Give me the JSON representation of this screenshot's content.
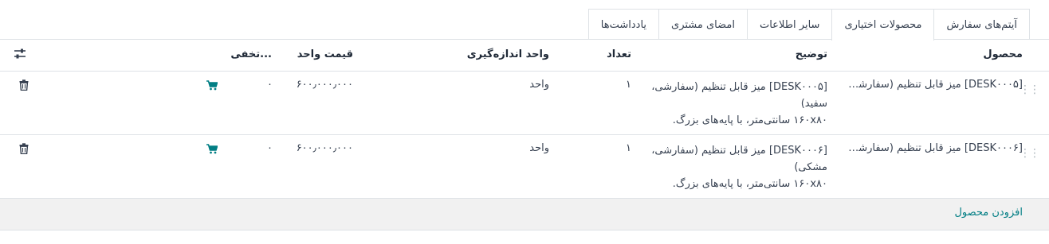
{
  "tabs": [
    {
      "label": "آیتم‌های سفارش",
      "active": false
    },
    {
      "label": "محصولات اختیاری",
      "active": true
    },
    {
      "label": "سایر اطلاعات",
      "active": false
    },
    {
      "label": "امضای مشتری",
      "active": false
    },
    {
      "label": "یادداشت‌ها",
      "active": false
    }
  ],
  "table": {
    "headers": {
      "product": "محصول",
      "description": "توضیح",
      "quantity": "تعداد",
      "uom": "واحد اندازه‌گیری",
      "unit_price": "قیمت واحد",
      "discount": "تخفی..."
    },
    "rows": [
      {
        "product": "[DESK۰۰۰۵] میز قابل تنظیم (سفارشی، ...",
        "description_line1": "[DESK۰۰۰۵] میز قابل تنظیم (سفارشی، سفید)",
        "description_line2": "۱۶۰x۸۰ سانتی‌متر، با پایه‌های بزرگ.",
        "quantity": "۱",
        "uom": "واحد",
        "unit_price": "۶۰۰٫۰۰۰٫۰۰۰",
        "discount": "۰"
      },
      {
        "product": "[DESK۰۰۰۶] میز قابل تنظیم (سفارشی، م...",
        "description_line1": "[DESK۰۰۰۶] میز قابل تنظیم (سفارشی، مشکی)",
        "description_line2": "۱۶۰x۸۰ سانتی‌متر، با پایه‌های بزرگ.",
        "quantity": "۱",
        "uom": "واحد",
        "unit_price": "۶۰۰٫۰۰۰٫۰۰۰",
        "discount": "۰"
      }
    ],
    "add_product": "افزودن محصول"
  },
  "colors": {
    "accent": "#017e84",
    "border": "#dee2e6",
    "add_row_bg": "#f1f1f1"
  },
  "icons": {
    "settings": "sliders-icon",
    "cart": "cart-icon",
    "delete": "trash-icon",
    "handle": "drag-handle-icon"
  }
}
